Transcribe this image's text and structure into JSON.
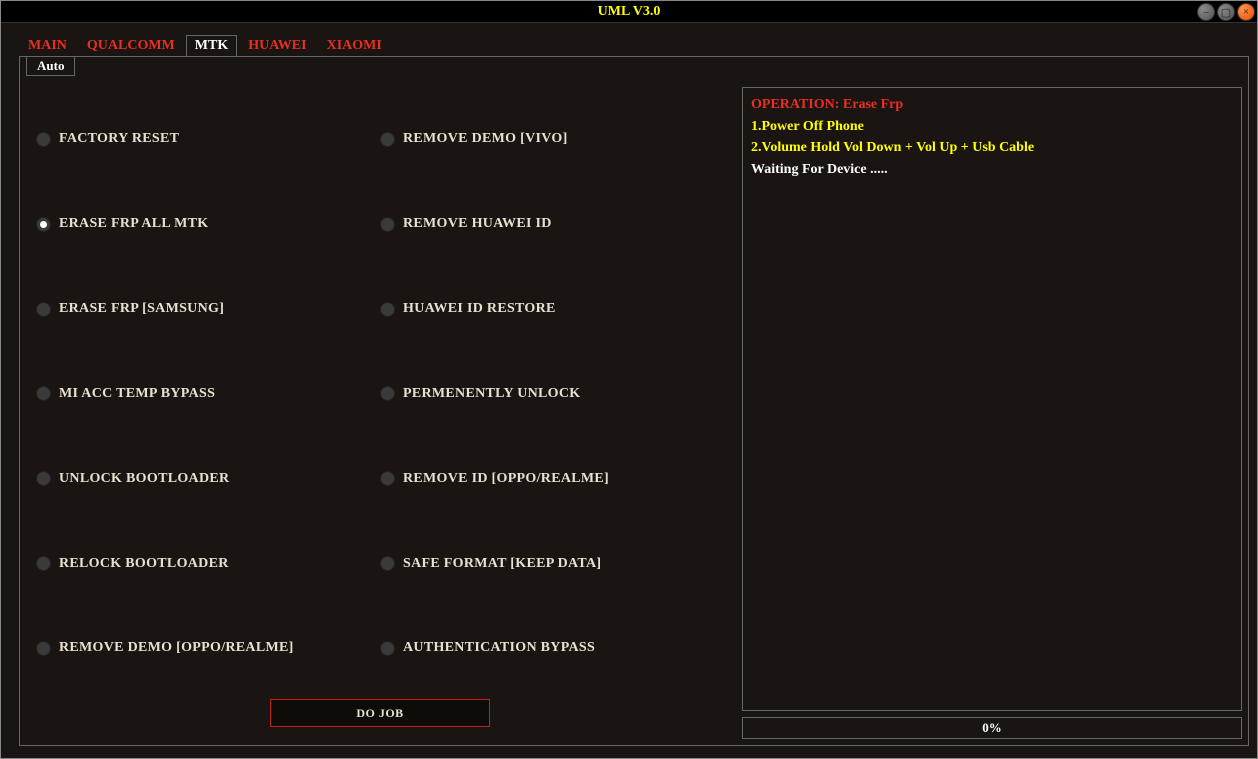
{
  "window": {
    "title": "UML V3.0"
  },
  "tabs": {
    "items": [
      {
        "label": "MAIN",
        "active": false
      },
      {
        "label": "QUALCOMM",
        "active": false
      },
      {
        "label": "MTK",
        "active": true
      },
      {
        "label": "HUAWEI",
        "active": false
      },
      {
        "label": "XIAOMI",
        "active": false
      }
    ]
  },
  "subtabs": {
    "items": [
      {
        "label": "Auto"
      }
    ]
  },
  "options": {
    "left": [
      {
        "label": "FACTORY RESET",
        "selected": false
      },
      {
        "label": "ERASE FRP ALL MTK",
        "selected": true
      },
      {
        "label": "ERASE FRP [SAMSUNG]",
        "selected": false
      },
      {
        "label": "MI ACC TEMP BYPASS",
        "selected": false
      },
      {
        "label": "UNLOCK BOOTLOADER",
        "selected": false
      },
      {
        "label": "RELOCK BOOTLOADER",
        "selected": false
      },
      {
        "label": "REMOVE DEMO [OPPO/REALME]",
        "selected": false
      }
    ],
    "right": [
      {
        "label": "REMOVE DEMO [VIVO]",
        "selected": false
      },
      {
        "label": "REMOVE HUAWEI ID",
        "selected": false
      },
      {
        "label": "HUAWEI ID RESTORE",
        "selected": false
      },
      {
        "label": "PERMENENTLY UNLOCK",
        "selected": false
      },
      {
        "label": "REMOVE ID [OPPO/REALME]",
        "selected": false
      },
      {
        "label": "SAFE FORMAT [KEEP DATA]",
        "selected": false
      },
      {
        "label": "AUTHENTICATION BYPASS",
        "selected": false
      }
    ]
  },
  "action_button": "DO JOB",
  "log": {
    "operation": "OPERATION: Erase Frp",
    "step1": "1.Power Off Phone",
    "step2": "2.Volume Hold Vol Down + Vol Up + Usb Cable",
    "waiting": "Waiting For Device ....."
  },
  "progress": {
    "text": "0%"
  }
}
